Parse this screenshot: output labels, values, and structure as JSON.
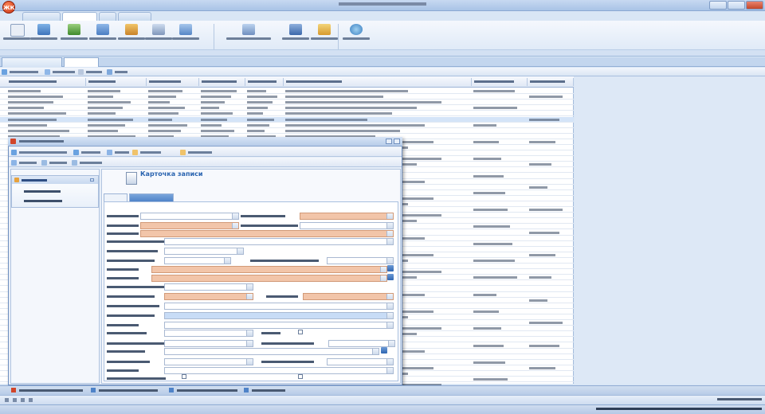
{
  "app": {
    "logo_text": "ЖК",
    "title": "",
    "ribbon_tabs": [
      "",
      "",
      "",
      ""
    ]
  },
  "modal": {
    "card_title": "Карточка записи",
    "card_subtitle": "",
    "form_tabs": [
      "",
      ""
    ]
  },
  "grid": {
    "row_count": 53,
    "selected_row_index": 5
  },
  "colors": {
    "accent": "#2a64b0",
    "required_field": "#f2c5a9",
    "selected_row": "#d4e4f8",
    "ribbon": "#dbe7f6"
  }
}
